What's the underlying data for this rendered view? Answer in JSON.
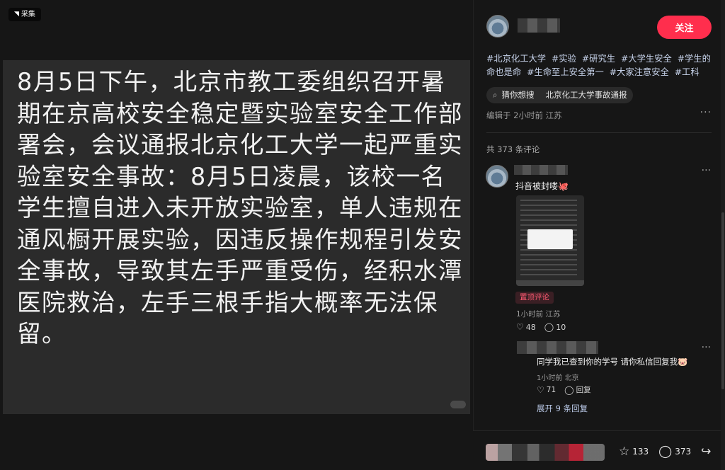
{
  "media": {
    "collect_label": "采集",
    "note_text": "8月5日下午，北京市教工委组织召开暑期在京高校安全稳定暨实验室安全工作部署会，会议通报北京化工大学一起严重实验室安全事故：8月5日凌晨，该校一名学生擅自进入未开放实验室，单人违规在通风橱开展实验，因违反操作规程引发安全事故，导致其左手严重受伤，经积水潭医院救治，左手三根手指大概率无法保留。"
  },
  "panel": {
    "follow_label": "关注",
    "tags": [
      "#北京化工大学",
      "#实验",
      "#研究生",
      "#大学生安全",
      "#学生的命也是命",
      "#生命至上安全第一",
      "#大家注意安全",
      "#工科"
    ],
    "guess_label": "猜你想搜",
    "guess_query": "北京化工大学事故通报",
    "edit_info": "编辑于 2小时前 江苏",
    "more": "···",
    "comment_count": "共 373 条评论"
  },
  "comment": {
    "text": "抖音被封喽🐙",
    "pin_label": "置顶评论",
    "meta": "1小时前 江苏",
    "likes": "48",
    "replies": "10",
    "more": "···"
  },
  "reply": {
    "text": "同学我已查到你的学号 请你私信回复我🐷",
    "meta": "1小时前 北京",
    "likes": "71",
    "reply_label": "回复",
    "more": "···",
    "expand_label": "展开 9 条回复"
  },
  "bottom": {
    "stars": "133",
    "comments": "373"
  },
  "colors": {
    "accent": "#ff2e4d",
    "tag": "#c6d2ea",
    "pin": "#ff5a72"
  }
}
